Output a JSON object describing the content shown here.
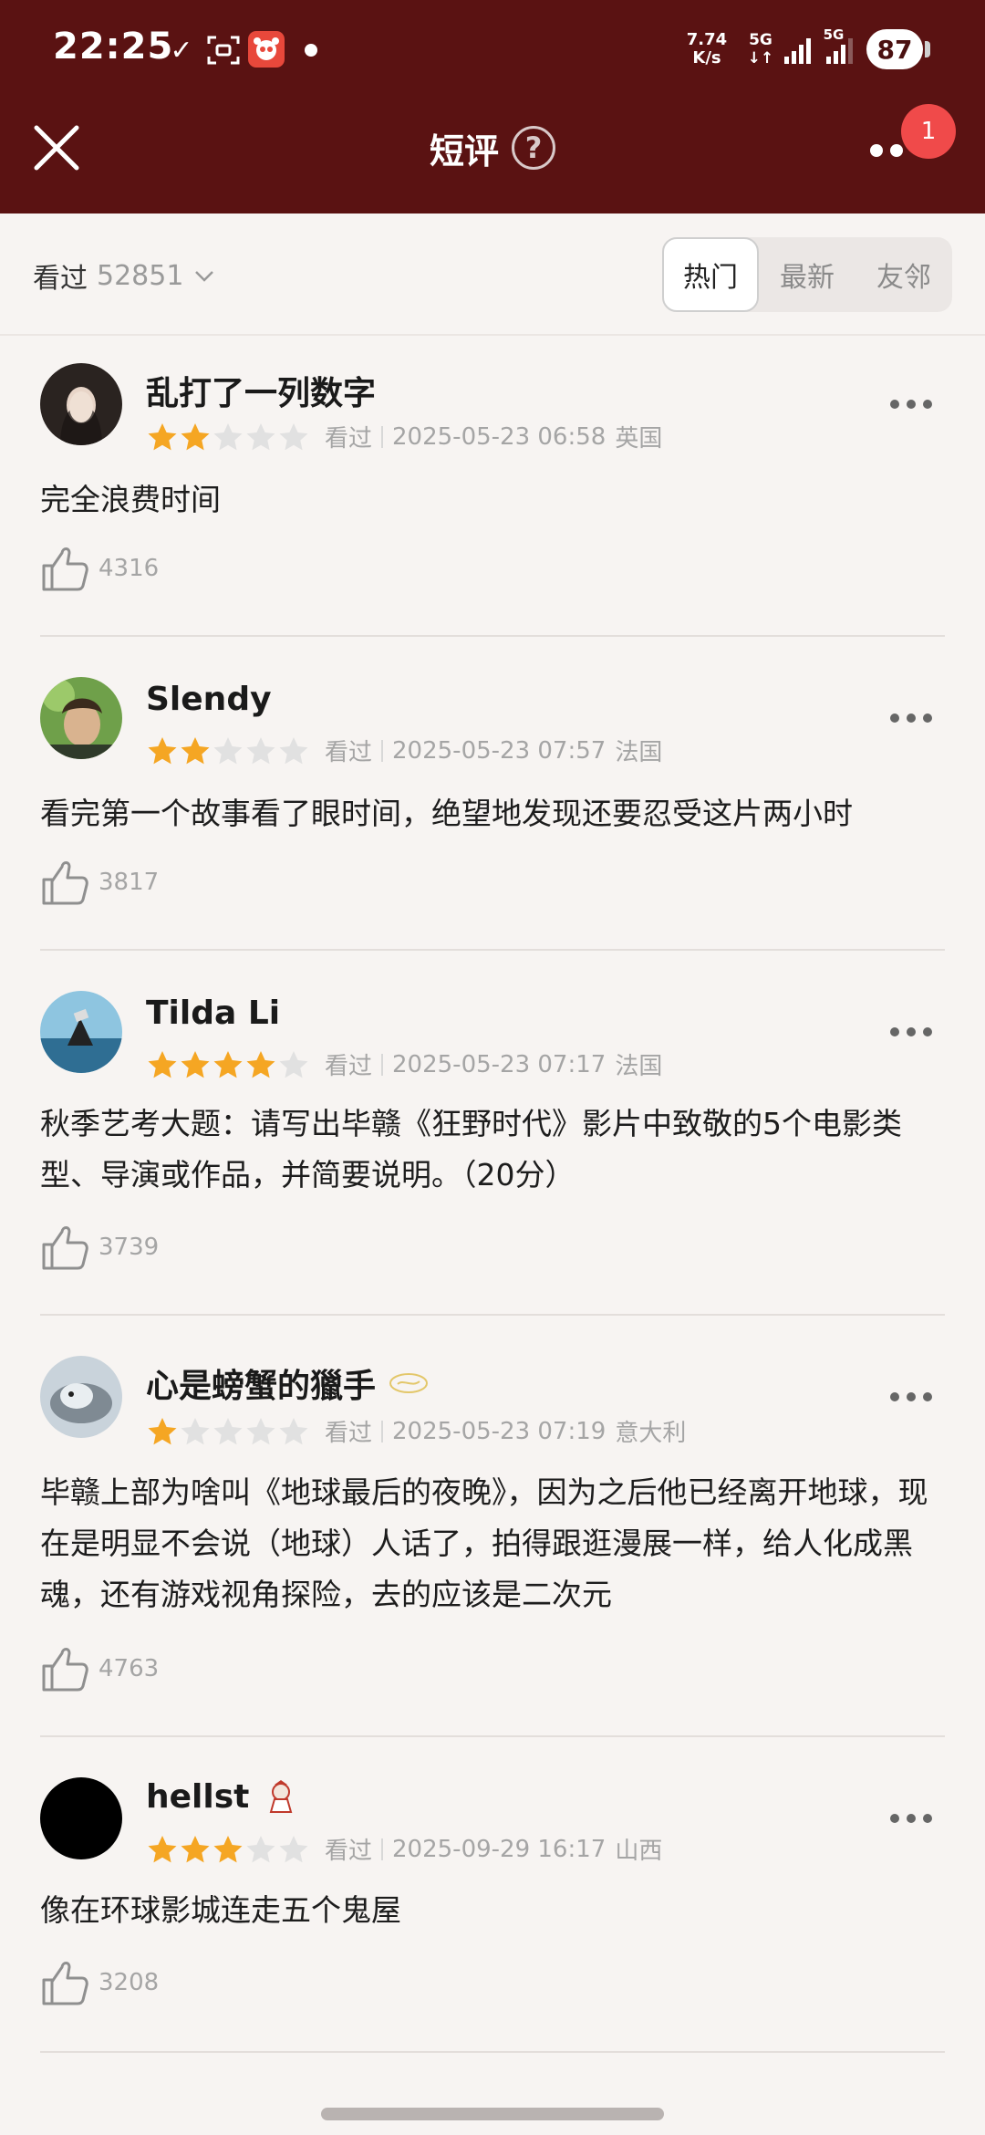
{
  "status_bar": {
    "time": "22:25",
    "net_speed_value": "7.74",
    "net_speed_unit": "K/s",
    "net1": "5G",
    "net2": "5G",
    "battery": "87"
  },
  "header": {
    "title": "短评",
    "help_symbol": "?",
    "notification_count": "1"
  },
  "filter": {
    "watched_label": "看过",
    "watched_count": "52851",
    "tabs": [
      {
        "label": "热门",
        "active": true
      },
      {
        "label": "最新",
        "active": false
      },
      {
        "label": "友邻",
        "active": false
      }
    ]
  },
  "comments": [
    {
      "username": "乱打了一列数字",
      "rating": 2,
      "status": "看过",
      "datetime": "2025-05-23 06:58",
      "location": "英国",
      "text": "完全浪费时间",
      "likes": "4316"
    },
    {
      "username": "Slendy",
      "rating": 2,
      "status": "看过",
      "datetime": "2025-05-23 07:57",
      "location": "法国",
      "text": "看完第一个故事看了眼时间，绝望地发现还要忍受这片两小时",
      "likes": "3817"
    },
    {
      "username": "Tilda Li",
      "rating": 4,
      "status": "看过",
      "datetime": "2025-05-23 07:17",
      "location": "法国",
      "text": "秋季艺考大题：请写出毕赣《狂野时代》影片中致敬的5个电影类型、导演或作品，并简要说明。（20分）",
      "likes": "3739"
    },
    {
      "username": "心是螃蟹的獵手",
      "rating": 1,
      "status": "看过",
      "datetime": "2025-05-23 07:19",
      "location": "意大利",
      "text": "毕赣上部为啥叫《地球最后的夜晚》，因为之后他已经离开地球，现在是明显不会说（地球）人话了，拍得跟逛漫展一样，给人化成黑魂，还有游戏视角探险，去的应该是二次元",
      "likes": "4763"
    },
    {
      "username": "hellst",
      "rating": 3,
      "status": "看过",
      "datetime": "2025-09-29 16:17",
      "location": "山西",
      "text": "像在环球影城连走五个鬼屋",
      "likes": "3208"
    }
  ],
  "colors": {
    "header_bg": "#5a1212",
    "star_on": "#f5a623",
    "star_off": "#e1e1e1",
    "badge_red": "#f04a4a"
  },
  "icons": [
    "check-icon",
    "scan-icon",
    "app-icon",
    "signal-icon",
    "close-icon",
    "help-icon",
    "more-icon",
    "chevron-down-icon",
    "star-icon",
    "more-dots-icon",
    "thumbs-up-icon",
    "user-badge-icon"
  ]
}
